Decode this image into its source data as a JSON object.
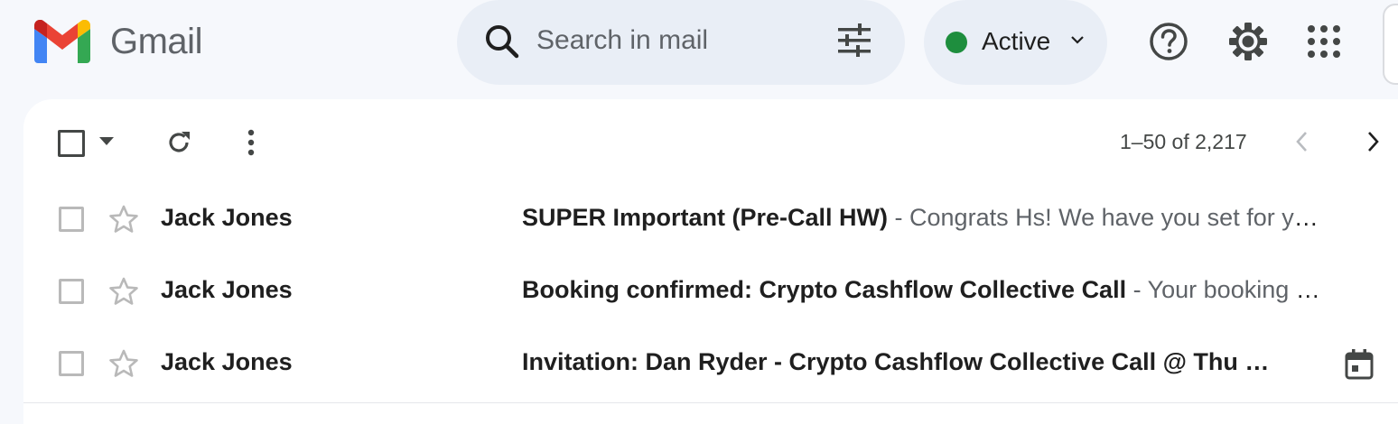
{
  "app": {
    "name": "Gmail"
  },
  "search": {
    "placeholder": "Search in mail"
  },
  "status": {
    "label": "Active",
    "color": "#1e8e3e"
  },
  "icons": {
    "search": "search-icon",
    "filter": "tune-icon",
    "help": "help-icon",
    "settings": "gear-icon",
    "apps": "apps-grid-icon",
    "refresh": "refresh-icon",
    "more": "more-vert-icon",
    "star": "star-outline-icon",
    "calendar": "calendar-icon"
  },
  "pager": {
    "range": "1–50 of 2,217"
  },
  "emails": [
    {
      "sender": "Jack Jones",
      "subject": "SUPER Important (Pre-Call HW)",
      "separator": " - ",
      "snippet": "Congrats Hs! We have you set for your call! Please complete the following before your call"
    },
    {
      "sender": "Jack Jones",
      "subject": "Booking confirmed: Crypto Cashflow Collective Call",
      "separator": " - ",
      "snippet": "Your booking is confirmed"
    },
    {
      "sender": "Jack Jones",
      "subject": "Invitation: Dan Ryder - Crypto Cashflow Collective Call @ Thu …",
      "separator": "",
      "snippet": ""
    }
  ]
}
